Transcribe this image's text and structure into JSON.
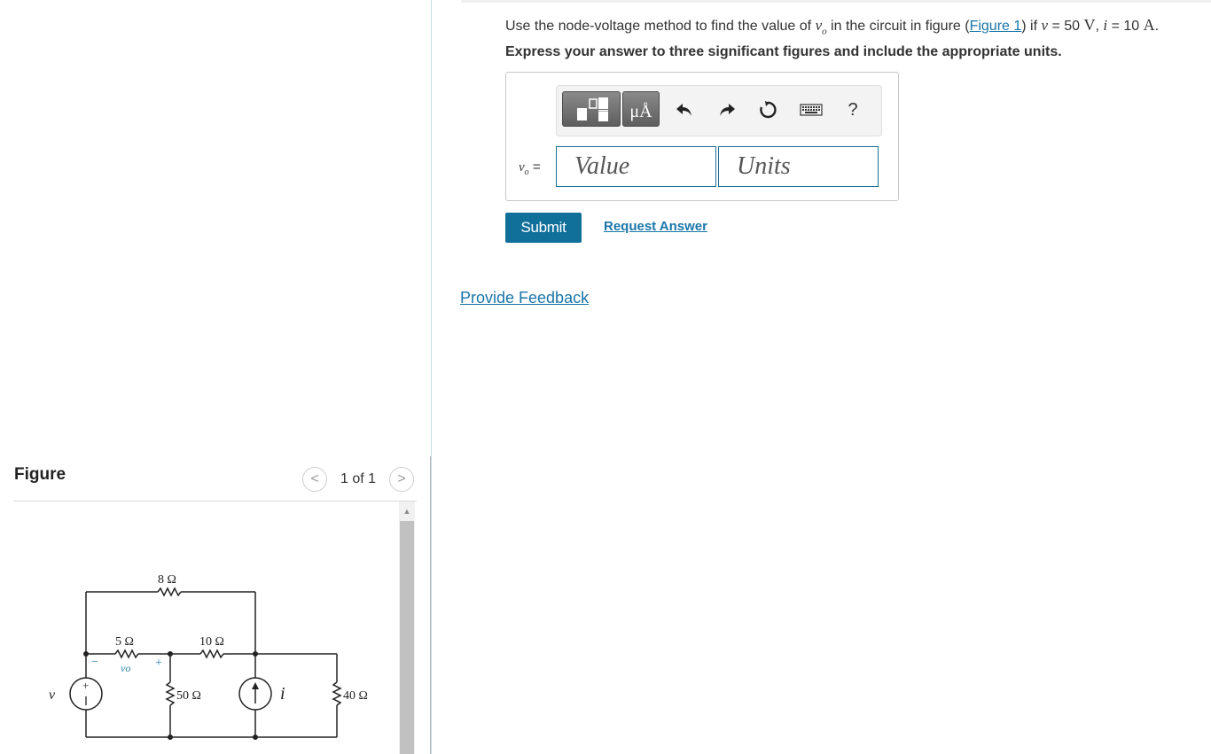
{
  "question": {
    "prefix": "Use the node-voltage method to find the value of ",
    "var_vo": "vo",
    "mid": " in the circuit in figure (",
    "figure_link": "Figure 1",
    "mid2": ") if ",
    "var_v": "v",
    "eq1": " = 50 ",
    "unit_v": "V",
    "comma": ", ",
    "var_i": "i",
    "eq2": " = 10 ",
    "unit_a": "A",
    "period": ".",
    "instructions": "Express your answer to three significant figures and include the appropriate units."
  },
  "answer": {
    "label_var": "vo",
    "label_eq": " =",
    "value_placeholder": "Value",
    "units_placeholder": "Units",
    "toolbar": {
      "units_button": "μÅ",
      "undo_icon": "undo-icon",
      "redo_icon": "redo-icon",
      "reset_icon": "reset-icon",
      "keyboard_icon": "keyboard-icon",
      "help": "?"
    }
  },
  "actions": {
    "submit": "Submit",
    "request_answer": "Request Answer",
    "feedback": "Provide Feedback"
  },
  "figure": {
    "title": "Figure",
    "pager": "1 of 1",
    "prev": "<",
    "next": ">",
    "labels": {
      "r8": "8 Ω",
      "r5": "5 Ω",
      "r10": "10 Ω",
      "r50": "50 Ω",
      "r40": "40 Ω",
      "vo": "vo",
      "v": "v",
      "i": "i",
      "minus": "−",
      "plus": "+"
    }
  },
  "colors": {
    "link": "#1a75a8",
    "submit_bg": "#11709a",
    "field_border": "#1a6f94"
  }
}
